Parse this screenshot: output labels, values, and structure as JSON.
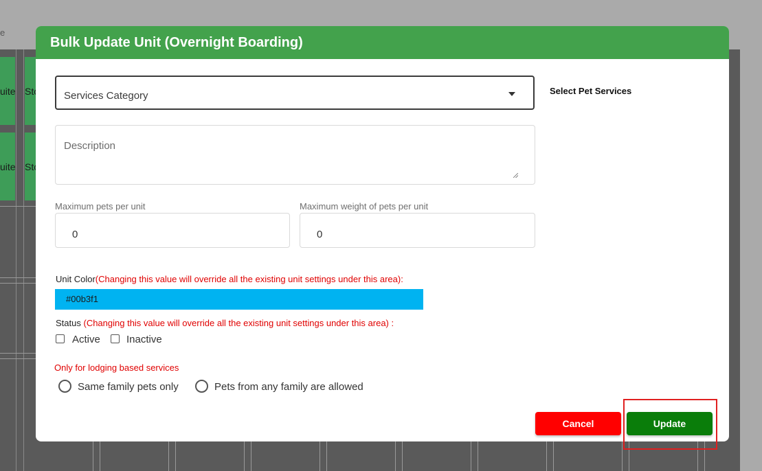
{
  "background": {
    "top_text": "e",
    "tiles": [
      "uite",
      "Sto",
      "uite",
      "Sto"
    ]
  },
  "modal": {
    "title": "Bulk Update Unit (Overnight Boarding)",
    "services_category": {
      "label": "Services Category"
    },
    "select_pet_services_label": "Select Pet Services",
    "description": {
      "placeholder": "Description"
    },
    "max_pets": {
      "label": "Maximum pets per unit",
      "value": "0"
    },
    "max_weight": {
      "label": "Maximum weight of pets per unit",
      "value": "0"
    },
    "unit_color": {
      "label": "Unit Color",
      "warning": "(Changing this value will override all the existing unit settings under this area):",
      "value": "#00b3f1"
    },
    "status": {
      "label": "Status",
      "warning": "(Changing this value will override all the existing unit settings under this area) :",
      "options": [
        "Active",
        "Inactive"
      ]
    },
    "lodging_note": "Only for lodging based services",
    "family_options": [
      "Same family pets only",
      "Pets from any family are allowed"
    ],
    "cancel_label": "Cancel",
    "update_label": "Update"
  },
  "colors": {
    "header": "#43a24c",
    "cancel": "#ff0000",
    "update": "#0a7d0a",
    "warning": "#e00000",
    "unit_color": "#00b3f1"
  }
}
